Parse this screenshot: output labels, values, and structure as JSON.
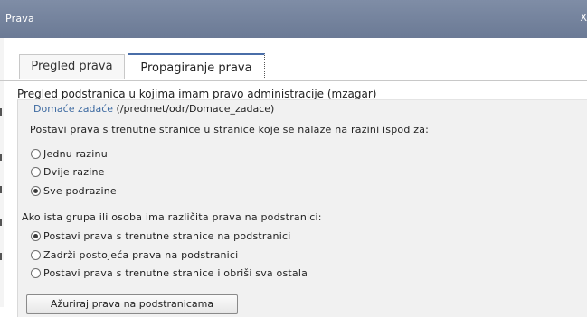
{
  "window": {
    "title": "Prava",
    "close_label": "X"
  },
  "tabs": [
    {
      "label": "Pregled prava",
      "active": false
    },
    {
      "label": "Propagiranje prava",
      "active": true
    }
  ],
  "heading": "Pregled podstranica u kojima imam pravo administracije (mzagar)",
  "page_path": {
    "link_text": "Domaće zadaće",
    "path_text": "(/predmet/odr/Domace_zadace)"
  },
  "propagation": {
    "instruction": "Postavi prava s trenutne stranice u stranice koje se nalaze na razini ispod za:",
    "depth_options": [
      {
        "label": "Jednu razinu",
        "selected": false
      },
      {
        "label": "Dvije razine",
        "selected": false
      },
      {
        "label": "Sve podrazine",
        "selected": true
      }
    ],
    "conflict_question": "Ako ista grupa ili osoba ima različita prava na podstranici:",
    "conflict_options": [
      {
        "label": "Postavi prava s trenutne stranice na podstranici",
        "selected": true
      },
      {
        "label": "Zadrži postojeća prava na podstranici",
        "selected": false
      },
      {
        "label": "Postavi prava s trenutne stranice i obriši sva ostala",
        "selected": false
      }
    ],
    "submit_label": "Ažuriraj prava na podstranicama"
  }
}
